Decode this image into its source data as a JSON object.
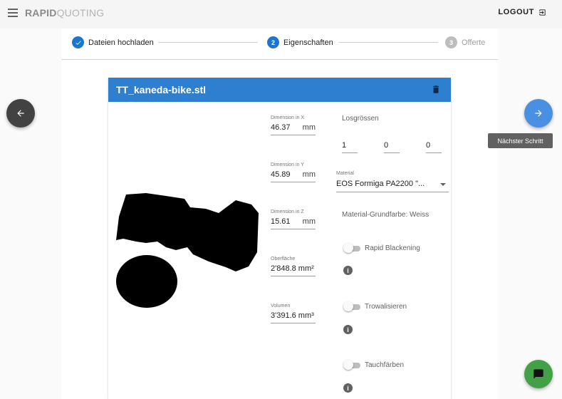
{
  "app": {
    "brand_bold": "RAPID",
    "brand_light": "QUOTING",
    "logout_label": "LOGOUT"
  },
  "stepper": {
    "steps": [
      {
        "number": "",
        "label": "Dateien hochladen",
        "state": "done"
      },
      {
        "number": "2",
        "label": "Eigenschaften",
        "state": "active"
      },
      {
        "number": "3",
        "label": "Offerte",
        "state": "inactive"
      }
    ]
  },
  "part": {
    "filename": "TT_kaneda-bike.stl",
    "dimensions": [
      {
        "label": "Dimension in X",
        "value": "46.37",
        "unit": "mm"
      },
      {
        "label": "Dimension in Y",
        "value": "45.89",
        "unit": "mm"
      },
      {
        "label": "Dimension in Z",
        "value": "15.61",
        "unit": "mm"
      }
    ],
    "surface": {
      "label": "Oberfläche",
      "value": "2'848.8 mm²"
    },
    "volume": {
      "label": "Volumen",
      "value": "3'391.6 mm³"
    },
    "lot_sizes": {
      "label": "Losgrössen",
      "values": [
        "1",
        "0",
        "0"
      ]
    },
    "material": {
      "label": "Material",
      "value": "EOS Formiga PA2200 \"..."
    },
    "base_color": "Material-Grundfarbe: Weiss",
    "options": [
      {
        "label": "Rapid Blackening",
        "enabled": false
      },
      {
        "label": "Trowalisieren",
        "enabled": false
      },
      {
        "label": "Tauchfärben",
        "enabled": false
      }
    ]
  },
  "navigation": {
    "next_tooltip": "Nächster Schritt"
  },
  "colors": {
    "primary": "#2f7fd0",
    "fab_next": "#4a90e2",
    "fab_back": "#424242",
    "chat": "#43a047",
    "done_step": "#1976d2"
  }
}
